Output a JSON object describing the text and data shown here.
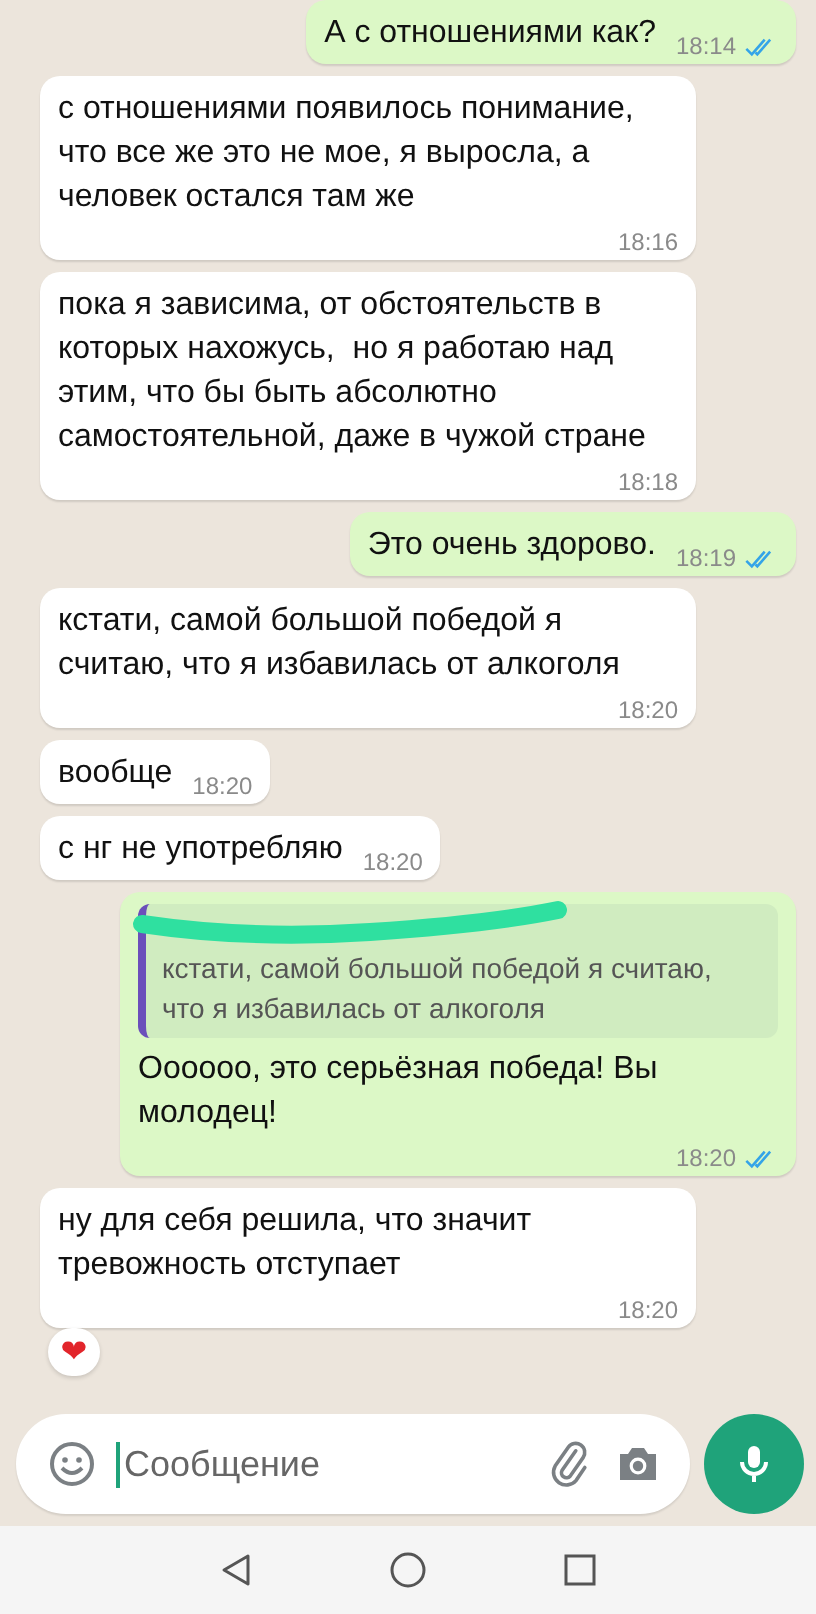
{
  "messages": [
    {
      "kind": "outgoing",
      "text": "А с отношениями как?",
      "time": "18:14",
      "read": true
    },
    {
      "kind": "incoming",
      "text": "с отношениями появилось понимание, что все же это не мое, я выросла, а человек остался там же",
      "time": "18:16"
    },
    {
      "kind": "incoming",
      "text": "пока я зависима, от обстоятельств в которых нахожусь,  но я работаю над этим, что бы быть абсолютно самостоятельной, даже в чужой стране",
      "time": "18:18"
    },
    {
      "kind": "outgoing",
      "text": "Это очень здорово.",
      "time": "18:19",
      "read": true
    },
    {
      "kind": "incoming",
      "text": "кстати, самой большой победой я считаю, что я избавилась от алкоголя",
      "time": "18:20"
    },
    {
      "kind": "incoming",
      "text": "вообще",
      "time": "18:20"
    },
    {
      "kind": "incoming",
      "text": "с нг не употребляю",
      "time": "18:20"
    },
    {
      "kind": "outgoing",
      "quote": {
        "text": "кстати, самой большой победой я считаю, что я избавилась от алкоголя"
      },
      "text": "Оооооо, это серьёзная победа! Вы молодец!",
      "time": "18:20",
      "read": true
    },
    {
      "kind": "incoming",
      "text": "ну для себя решила, что значит тревожность отступает",
      "time": "18:20",
      "reaction": "❤"
    }
  ],
  "composer": {
    "placeholder": "Сообщение"
  }
}
